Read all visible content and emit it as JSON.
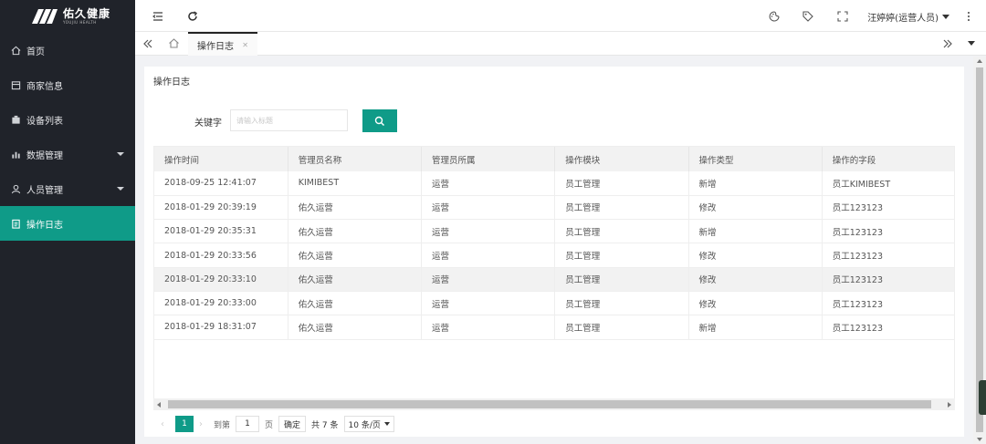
{
  "brand": {
    "name_cn": "佑久健康",
    "name_en": "YOUJIU HEALTH"
  },
  "sidebar": {
    "items": [
      {
        "label": "首页",
        "icon": "home-icon"
      },
      {
        "label": "商家信息",
        "icon": "store-icon"
      },
      {
        "label": "设备列表",
        "icon": "device-icon"
      },
      {
        "label": "数据管理",
        "icon": "chart-icon",
        "expandable": true
      },
      {
        "label": "人员管理",
        "icon": "user-icon",
        "expandable": true
      },
      {
        "label": "操作日志",
        "icon": "clipboard-icon",
        "active": true
      }
    ]
  },
  "header": {
    "user": "汪婷婷(运营人员)"
  },
  "tabs": [
    {
      "label": "操作日志"
    }
  ],
  "page": {
    "title": "操作日志",
    "search": {
      "label": "关键字",
      "placeholder": "请输入标题"
    }
  },
  "table": {
    "columns": [
      "操作时间",
      "管理员名称",
      "管理员所属",
      "操作模块",
      "操作类型",
      "操作的字段"
    ],
    "rows": [
      [
        "2018-09-25 12:41:07",
        "KIMIBEST",
        "运营",
        "员工管理",
        "新增",
        "员工KIMIBEST"
      ],
      [
        "2018-01-29 20:39:19",
        "佑久运营",
        "运营",
        "员工管理",
        "修改",
        "员工123123"
      ],
      [
        "2018-01-29 20:35:31",
        "佑久运营",
        "运营",
        "员工管理",
        "新增",
        "员工123123"
      ],
      [
        "2018-01-29 20:33:56",
        "佑久运营",
        "运营",
        "员工管理",
        "修改",
        "员工123123"
      ],
      [
        "2018-01-29 20:33:10",
        "佑久运营",
        "运营",
        "员工管理",
        "修改",
        "员工123123"
      ],
      [
        "2018-01-29 20:33:00",
        "佑久运营",
        "运营",
        "员工管理",
        "修改",
        "员工123123"
      ],
      [
        "2018-01-29 18:31:07",
        "佑久运营",
        "运营",
        "员工管理",
        "新增",
        "员工123123"
      ]
    ]
  },
  "pagination": {
    "current": "1",
    "goto_label": "到第",
    "goto_value": "1",
    "page_unit": "页",
    "confirm": "确定",
    "total": "共 7 条",
    "page_size": "10 条/页"
  },
  "colors": {
    "accent": "#0f9b88",
    "sidebar_bg": "#20232a"
  }
}
